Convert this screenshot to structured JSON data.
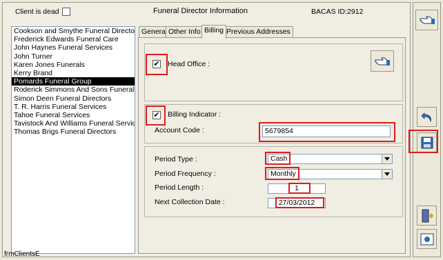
{
  "header": {
    "client_dead_label": "Client is dead",
    "client_dead_checked": false,
    "section_title": "Funeral Director Information",
    "bacas_label": "BACAS ID:",
    "bacas_value": "2912"
  },
  "directors": [
    "Cookson and Smythe Funeral Director",
    "Frederick Edwards Funeral Care",
    "John Haynes Funeral Services",
    "John Turner",
    "Karen Jones Funerals",
    "Kerry Brand",
    "Pomards Funeral Group",
    "Roderick Simmons And Sons Funeral Servi",
    "Simon Deen Funeral Directors",
    "T. R. Harris Funeral Services",
    "Tahoe Funeral Services",
    "Tavistock And Williams Funeral Services",
    "Thomas Brigs Funeral Directors"
  ],
  "selected_director_index": 6,
  "tabs": [
    {
      "label": "General",
      "active": false
    },
    {
      "label": "Other Info",
      "active": false
    },
    {
      "label": "Billing",
      "active": true
    },
    {
      "label": "Previous Addresses",
      "active": false
    }
  ],
  "billing": {
    "head_office_label": "Head Office :",
    "head_office_checked": true,
    "billing_indicator_label": "Billing Indicator :",
    "billing_indicator_checked": true,
    "account_code_label": "Account Code :",
    "account_code_value": "5679854",
    "period_type_label": "Period Type :",
    "period_type_value": "Cash",
    "period_frequency_label": "Period Frequency :",
    "period_frequency_value": "Monthly",
    "period_length_label": "Period Length :",
    "period_length_value": "1",
    "next_collection_label": "Next Collection Date :",
    "next_collection_value": "27/03/2012"
  },
  "status_bar": {
    "form_name": "frmClientsE"
  },
  "icons": {
    "toolbar": [
      "pointing-hand-icon",
      "undo-icon",
      "save-disk-icon",
      "exit-door-icon",
      "preview-icon"
    ],
    "head_office_button": "pointing-hand-icon"
  },
  "colors": {
    "highlight_red": "#e0191e",
    "selected_row": "#000000"
  }
}
